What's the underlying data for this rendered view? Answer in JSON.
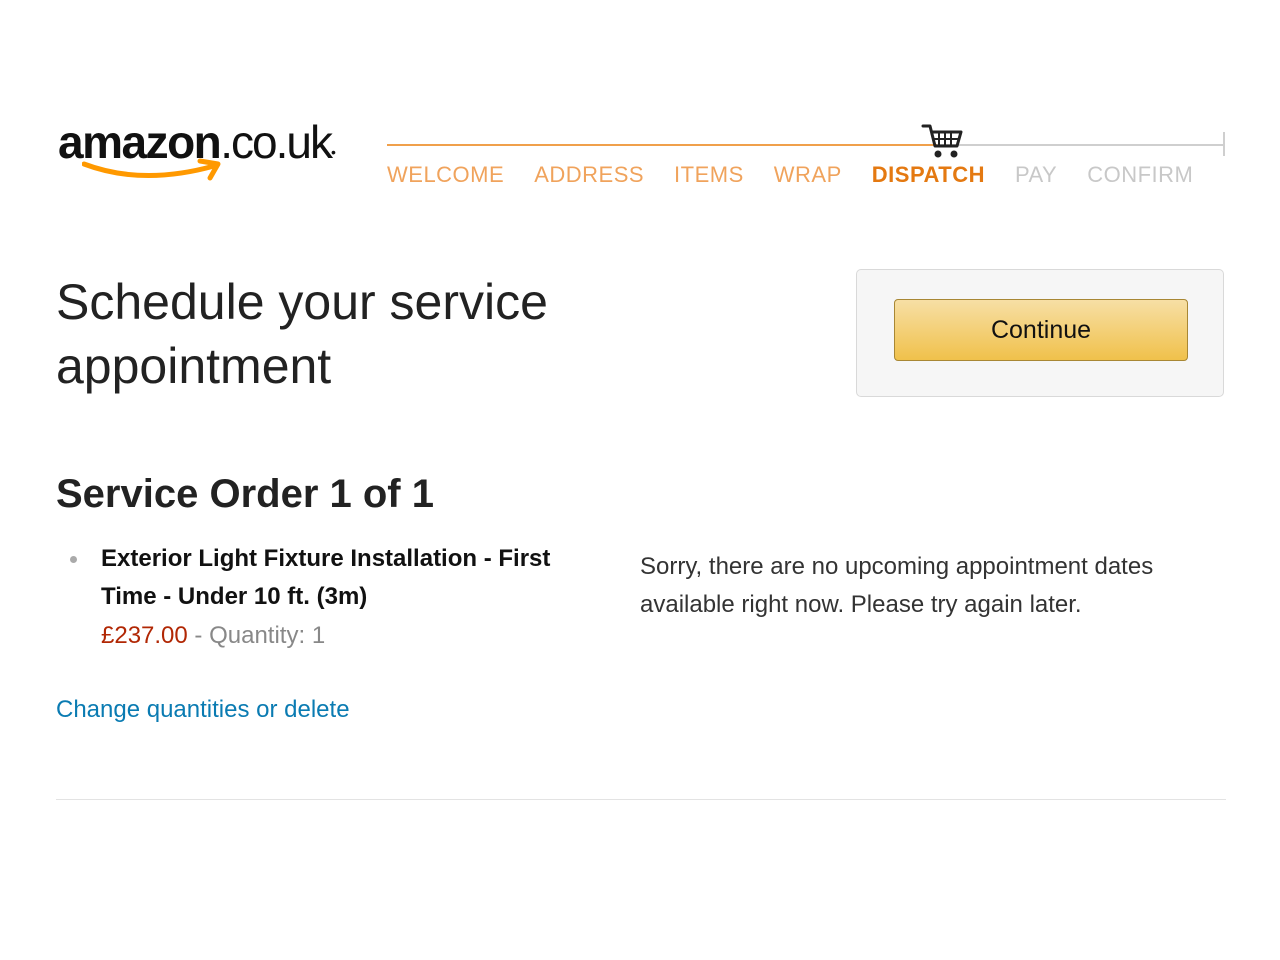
{
  "header": {
    "logo": {
      "brand": "amazon",
      "tld": ".co.uk",
      "mark": "•",
      "smile_color": "#f90"
    },
    "progress": {
      "cart_icon": "shopping-cart-icon",
      "steps": [
        {
          "label": "WELCOME",
          "state": "done"
        },
        {
          "label": "ADDRESS",
          "state": "done"
        },
        {
          "label": "ITEMS",
          "state": "done"
        },
        {
          "label": "WRAP",
          "state": "done"
        },
        {
          "label": "DISPATCH",
          "state": "current"
        },
        {
          "label": "PAY",
          "state": "pending"
        },
        {
          "label": "CONFIRM",
          "state": "pending"
        }
      ],
      "colors": {
        "done": "#f0a35c",
        "current": "#e47911",
        "pending": "#c8c8c8"
      }
    }
  },
  "main": {
    "title": "Schedule your service appointment",
    "continue_label": "Continue",
    "order": {
      "heading": "Service Order 1 of 1",
      "item": {
        "title": "Exterior Light Fixture Installation - First Time - Under 10 ft. (3m)",
        "price": "£237.00",
        "separator": " - ",
        "quantity_label": "Quantity: ",
        "quantity": "1"
      },
      "change_link": "Change quantities or delete"
    },
    "no_dates_message": "Sorry, there are no upcoming appointment dates available right now. Please try again later."
  },
  "colors": {
    "accent_orange": "#e47911",
    "price_red": "#b12704",
    "link_blue": "#0a7bb2",
    "button_yellow": "#f0c14b"
  }
}
